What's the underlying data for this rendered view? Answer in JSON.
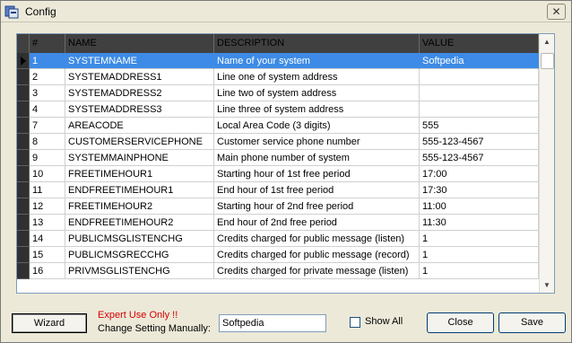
{
  "window": {
    "title": "Config",
    "close_glyph": "✕"
  },
  "grid": {
    "columns": [
      "#",
      "NAME",
      "DESCRIPTION",
      "VALUE"
    ],
    "rows": [
      {
        "id": "1",
        "name": "SYSTEMNAME",
        "description": "Name of your system",
        "value": "Softpedia",
        "selected": true
      },
      {
        "id": "2",
        "name": "SYSTEMADDRESS1",
        "description": "Line one of system address",
        "value": ""
      },
      {
        "id": "3",
        "name": "SYSTEMADDRESS2",
        "description": "Line two of system address",
        "value": ""
      },
      {
        "id": "4",
        "name": "SYSTEMADDRESS3",
        "description": "Line three of system address",
        "value": ""
      },
      {
        "id": "7",
        "name": "AREACODE",
        "description": "Local Area Code (3 digits)",
        "value": "555"
      },
      {
        "id": "8",
        "name": "CUSTOMERSERVICEPHONE",
        "description": "Customer service phone number",
        "value": "555-123-4567"
      },
      {
        "id": "9",
        "name": "SYSTEMMAINPHONE",
        "description": "Main phone number of system",
        "value": "555-123-4567"
      },
      {
        "id": "10",
        "name": "FREETIMEHOUR1",
        "description": "Starting hour of 1st free period",
        "value": "17:00"
      },
      {
        "id": "11",
        "name": "ENDFREETIMEHOUR1",
        "description": "End hour of 1st free period",
        "value": "17:30"
      },
      {
        "id": "12",
        "name": "FREETIMEHOUR2",
        "description": "Starting hour of 2nd free period",
        "value": "11:00"
      },
      {
        "id": "13",
        "name": "ENDFREETIMEHOUR2",
        "description": "End hour of 2nd free period",
        "value": "11:30"
      },
      {
        "id": "14",
        "name": "PUBLICMSGLISTENCHG",
        "description": "Credits charged for public message (listen)",
        "value": "1"
      },
      {
        "id": "15",
        "name": "PUBLICMSGRECCHG",
        "description": "Credits charged for public message (record)",
        "value": "1"
      },
      {
        "id": "16",
        "name": "PRIVMSGLISTENCHG",
        "description": "Credits charged for private message (listen)",
        "value": "1"
      }
    ]
  },
  "bottom": {
    "wizard_label": "Wizard",
    "expert_warning": "Expert Use Only !!",
    "change_label": "Change Setting Manually:",
    "setting_value": "Softpedia",
    "show_all_label": "Show All",
    "close_label": "Close",
    "save_label": "Save"
  },
  "colors": {
    "selection": "#3d8be6",
    "warning": "#d40000",
    "header_bg": "#404040"
  },
  "icons": {
    "app": "app-window-icon",
    "row_pointer": "row-pointer-icon"
  }
}
